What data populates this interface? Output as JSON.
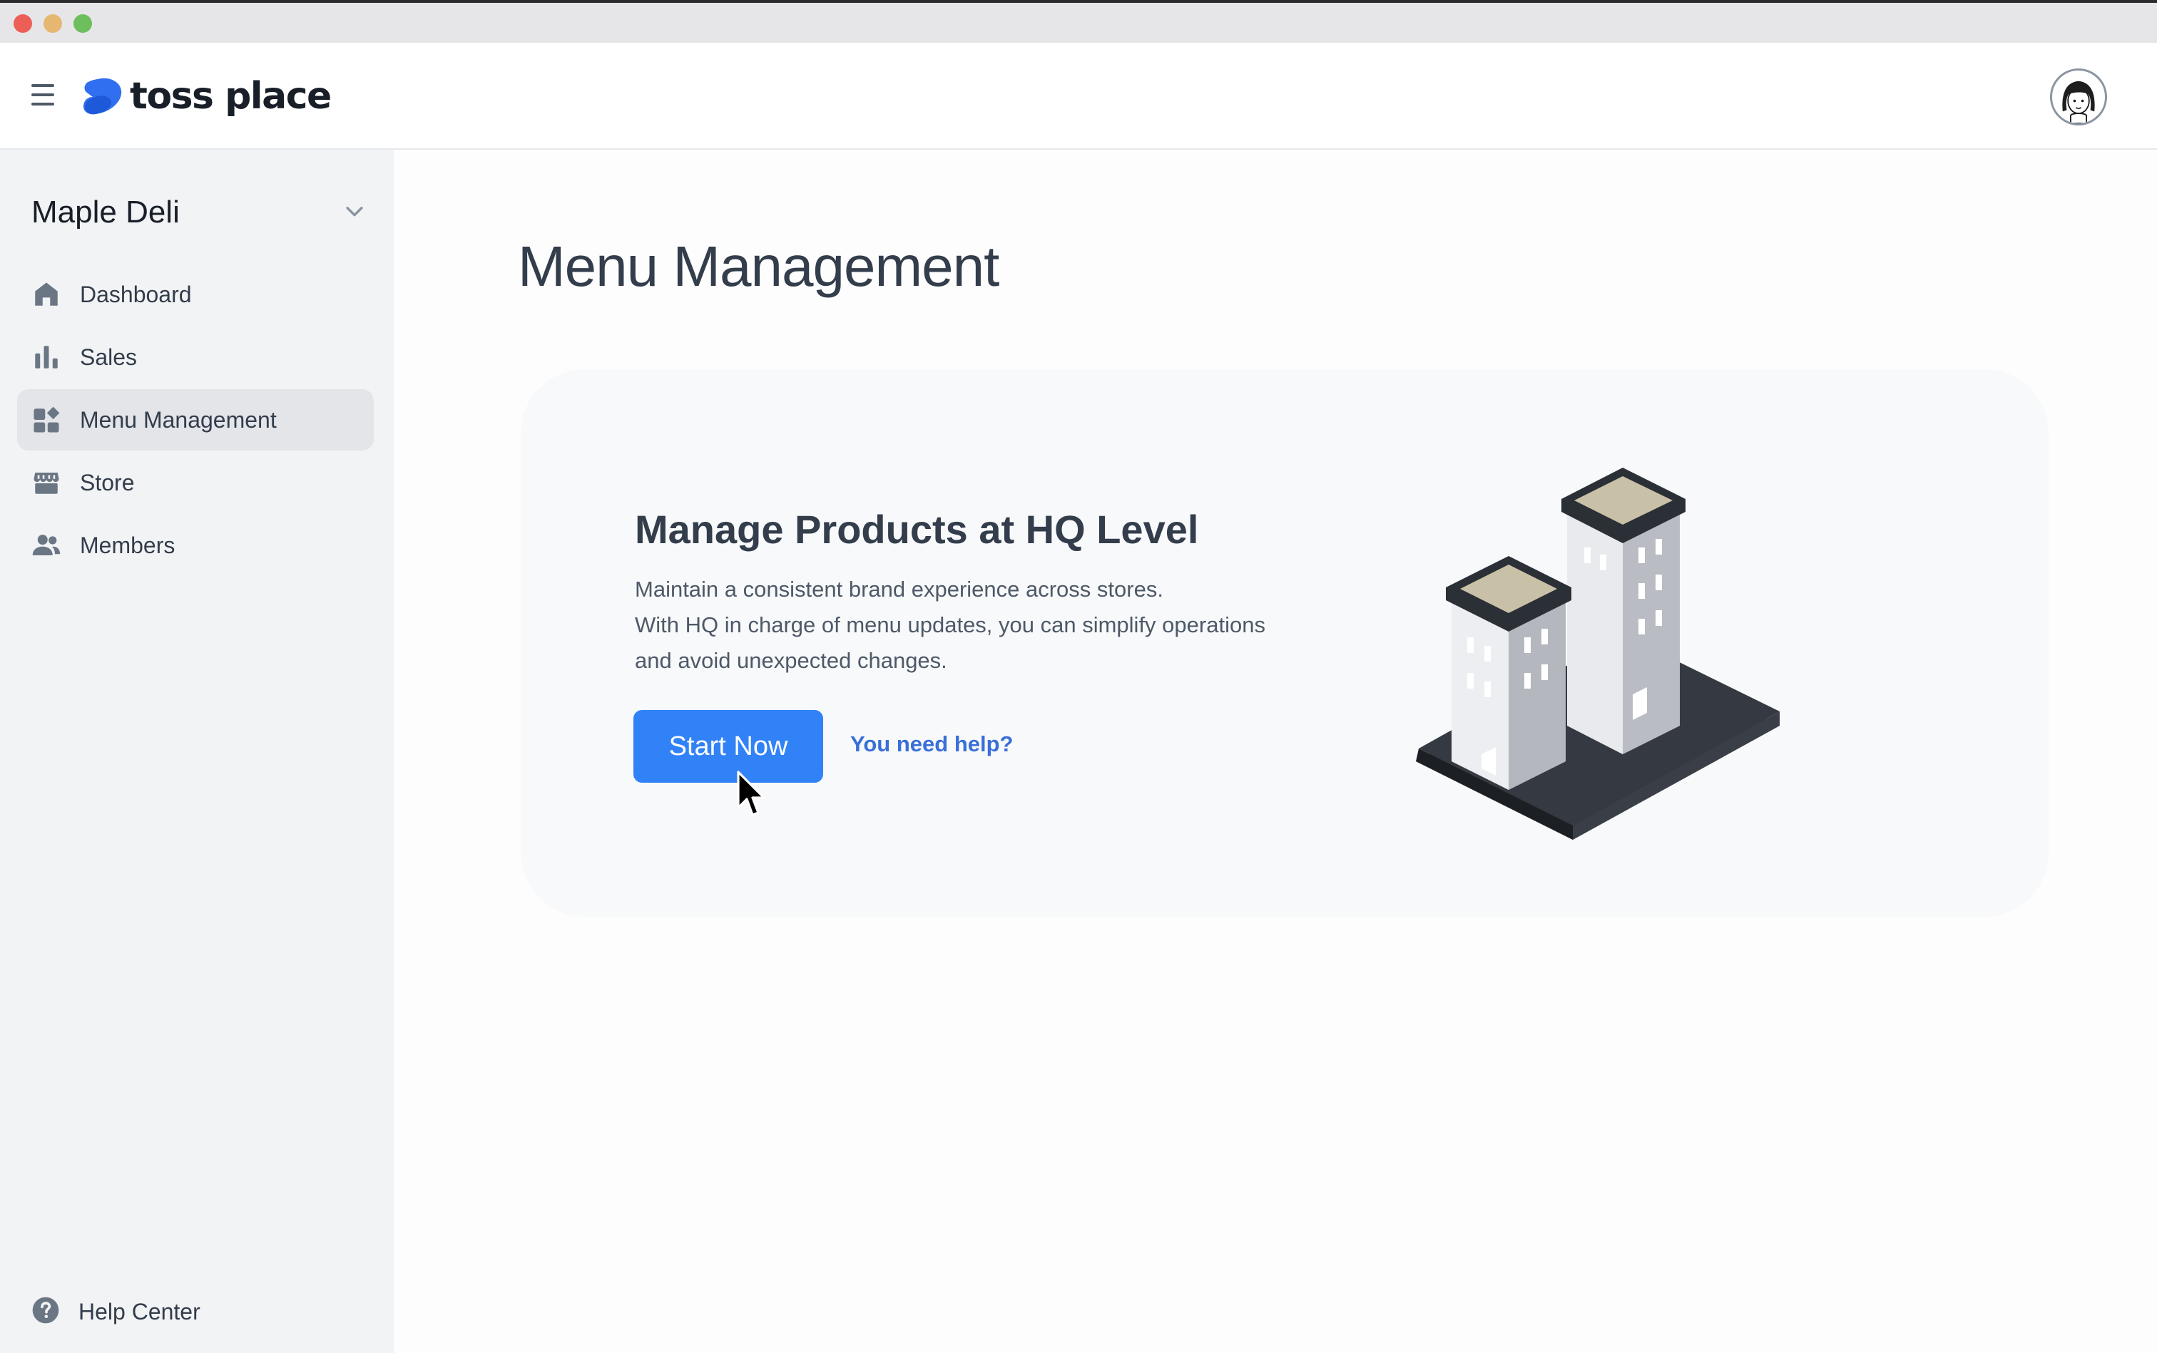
{
  "window": {
    "title_bar": ""
  },
  "header": {
    "brand": "toss place",
    "avatar_alt": "user avatar"
  },
  "sidebar": {
    "store_name": "Maple Deli",
    "items": [
      {
        "label": "Dashboard",
        "icon": "home-icon",
        "active": false
      },
      {
        "label": "Sales",
        "icon": "bar-chart-icon",
        "active": false
      },
      {
        "label": "Menu Management",
        "icon": "widgets-icon",
        "active": true
      },
      {
        "label": "Store",
        "icon": "storefront-icon",
        "active": false
      },
      {
        "label": "Members",
        "icon": "people-icon",
        "active": false
      }
    ],
    "help": {
      "label": "Help Center",
      "icon": "question-circle-icon"
    }
  },
  "main": {
    "title": "Menu Management",
    "card": {
      "heading": "Manage Products at HQ Level",
      "description": [
        "Maintain a consistent brand experience across stores.",
        "With HQ in charge of menu updates, you can simplify operations",
        "and avoid unexpected changes."
      ],
      "primary_button": "Start Now",
      "help_link": "You need help?",
      "illustration": "buildings-illustration"
    }
  },
  "colors": {
    "accent": "#3182f6",
    "link": "#3a6fd8",
    "sidebar_bg": "#f2f3f5",
    "active_item_bg": "#e3e5e8",
    "text_primary": "#333d4b"
  }
}
